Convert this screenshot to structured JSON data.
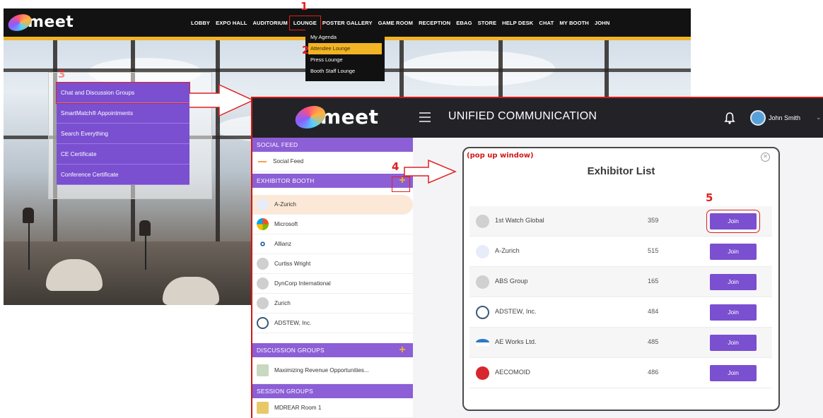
{
  "back_screen": {
    "logo_text": "meet",
    "nav_items": [
      "LOBBY",
      "EXPO HALL",
      "AUDITORIUM",
      "LOUNGE",
      "POSTER GALLERY",
      "GAME ROOM",
      "RECEPTION",
      "EBAG",
      "STORE",
      "HELP DESK",
      "CHAT",
      "MY BOOTH",
      "JOHN"
    ],
    "selected_nav": "LOUNGE",
    "dropdown_items": [
      "My Agenda",
      "Attendee Lounge",
      "Press Lounge",
      "Booth Staff Lounge"
    ],
    "selected_dropdown": "Attendee Lounge",
    "purple_menu": [
      "Chat and Discussion Groups",
      "SmartMatch® Appointments",
      "Search Everything",
      "CE Certificate",
      "Conference Certificate"
    ]
  },
  "steps": [
    "1",
    "2",
    "3",
    "4",
    "5"
  ],
  "front_screen": {
    "logo_text": "meet",
    "title": "UNIFIED COMMUNICATION",
    "user_name": "John Smith",
    "chevron": "⌄",
    "sidebar": {
      "social_feed_header": "SOCIAL FEED",
      "social_feed_item": "Social Feed",
      "exhibitor_booth_header": "EXHIBITOR BOOTH",
      "exhibitor_items": [
        "A-Zurich",
        "Microsoft",
        "Allianz",
        "Curtiss Wright",
        "DynCorp International",
        "Zurich",
        "ADSTEW, Inc."
      ],
      "discussion_header": "DISCUSSION GROUPS",
      "discussion_item": "Maximizing Revenue Opportunities...",
      "session_header": "SESSION GROUPS",
      "session_item": "MDREAR Room 1",
      "plus": "+"
    },
    "popup": {
      "tag": "(pop up window)",
      "title": "Exhibitor List",
      "close": "✕",
      "exhibitors": [
        {
          "name": "1st Watch Global",
          "number": "359",
          "join": "Join"
        },
        {
          "name": "A-Zurich",
          "number": "515",
          "join": "Join"
        },
        {
          "name": "ABS Group",
          "number": "165",
          "join": "Join"
        },
        {
          "name": "ADSTEW, Inc.",
          "number": "484",
          "join": "Join"
        },
        {
          "name": "AE Works Ltd.",
          "number": "485",
          "join": "Join"
        },
        {
          "name": "AECOMOID",
          "number": "486",
          "join": "Join"
        }
      ]
    }
  },
  "colors": {
    "purple": "#7a4fd0",
    "accent_yellow": "#f2b324",
    "annotation_red": "#e02020",
    "topbar": "#222227"
  }
}
